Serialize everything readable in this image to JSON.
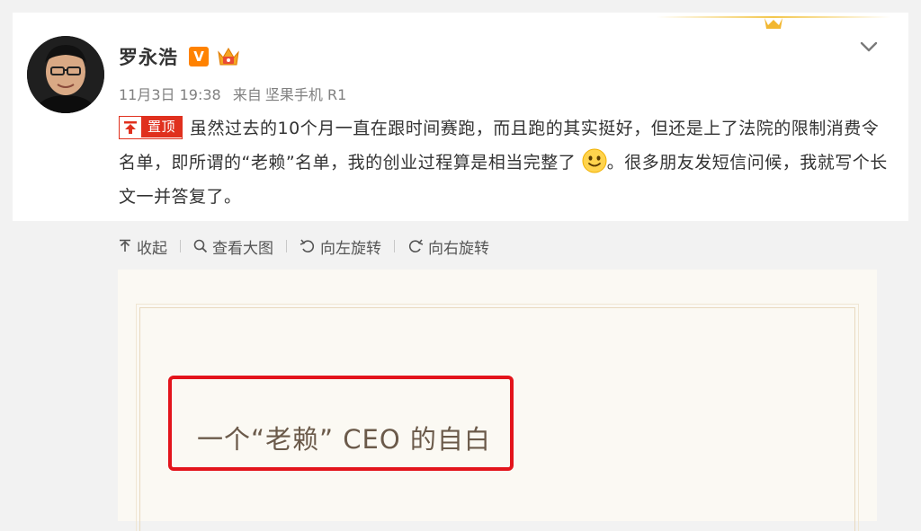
{
  "post": {
    "username": "罗永浩",
    "vip_label": "V",
    "date": "11月3日 19:38",
    "source_prefix": "来自",
    "source": "坚果手机 R1",
    "pin_label": "置顶",
    "text_part1": "虽然过去的10个月一直在跟时间赛跑，而且跑的其实挺好，但还是上了法院的限制消费令名单，即所谓的“老赖”名单，我的创业过程算是相当完整了",
    "text_part2": "。很多朋友发短信问候，我就写个长文一并答复了。"
  },
  "toolbar": {
    "collapse": "收起",
    "view_large": "查看大图",
    "rotate_left": "向左旋转",
    "rotate_right": "向右旋转"
  },
  "preview": {
    "title": "一个“老赖” CEO 的自白"
  },
  "colors": {
    "accent_red": "#e3141b",
    "vip_orange": "#ff8200",
    "text_main": "#333333",
    "text_meta": "#808080"
  },
  "icons": [
    "chevron-down-icon",
    "upload-icon",
    "magnifier-icon",
    "rotate-left-icon",
    "rotate-right-icon",
    "pin-icon",
    "smiley-icon",
    "crown-icon"
  ]
}
